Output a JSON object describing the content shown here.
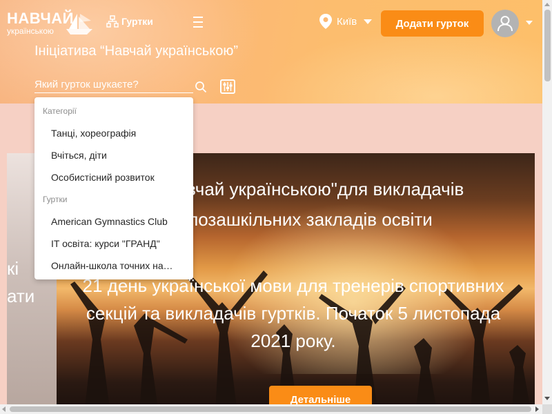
{
  "header": {
    "logo_line1": "НАВЧАЙ",
    "logo_line2": "українською",
    "clubs_label": "Гуртки",
    "city": "Київ",
    "add_club_label": "Додати гурток",
    "initiative_title": "Ініціатива “Навчай українською”"
  },
  "search": {
    "placeholder": "Який гурток шукаєте?",
    "value": ""
  },
  "dropdown": {
    "categories_label": "Категорії",
    "categories": [
      "Танці, хореографія",
      "Вчіться, діти",
      "Особистісний розвиток"
    ],
    "clubs_label": "Гуртки",
    "clubs": [
      "American Gymnastics Club",
      "IT освіта: курси \"ГРАНД\"",
      "Онлайн-школа точних наук \"Prime\""
    ]
  },
  "banner": {
    "left_text_1": "кі",
    "left_text_2": "ати",
    "title_line1": "\"Навчай українською\"для викладачів",
    "title_line2": "позашкільних закладів освіти",
    "text_line1": "21 день української мови для тренерів спортивних",
    "text_line2": "секцій та викладачів гуртків. Початок 5 листопада",
    "text_line3": "2021 року.",
    "button_label": "Детальніше"
  },
  "colors": {
    "accent": "#fa8c16",
    "header_gradient_start": "#f7b07a",
    "header_gradient_end": "#fdbf6a",
    "page_background": "#f6d0c4"
  },
  "icons": [
    "origami-boat-icon",
    "clubs-hierarchy-icon",
    "hamburger-menu-icon",
    "location-pin-icon",
    "user-icon",
    "search-icon",
    "filter-icon"
  ]
}
